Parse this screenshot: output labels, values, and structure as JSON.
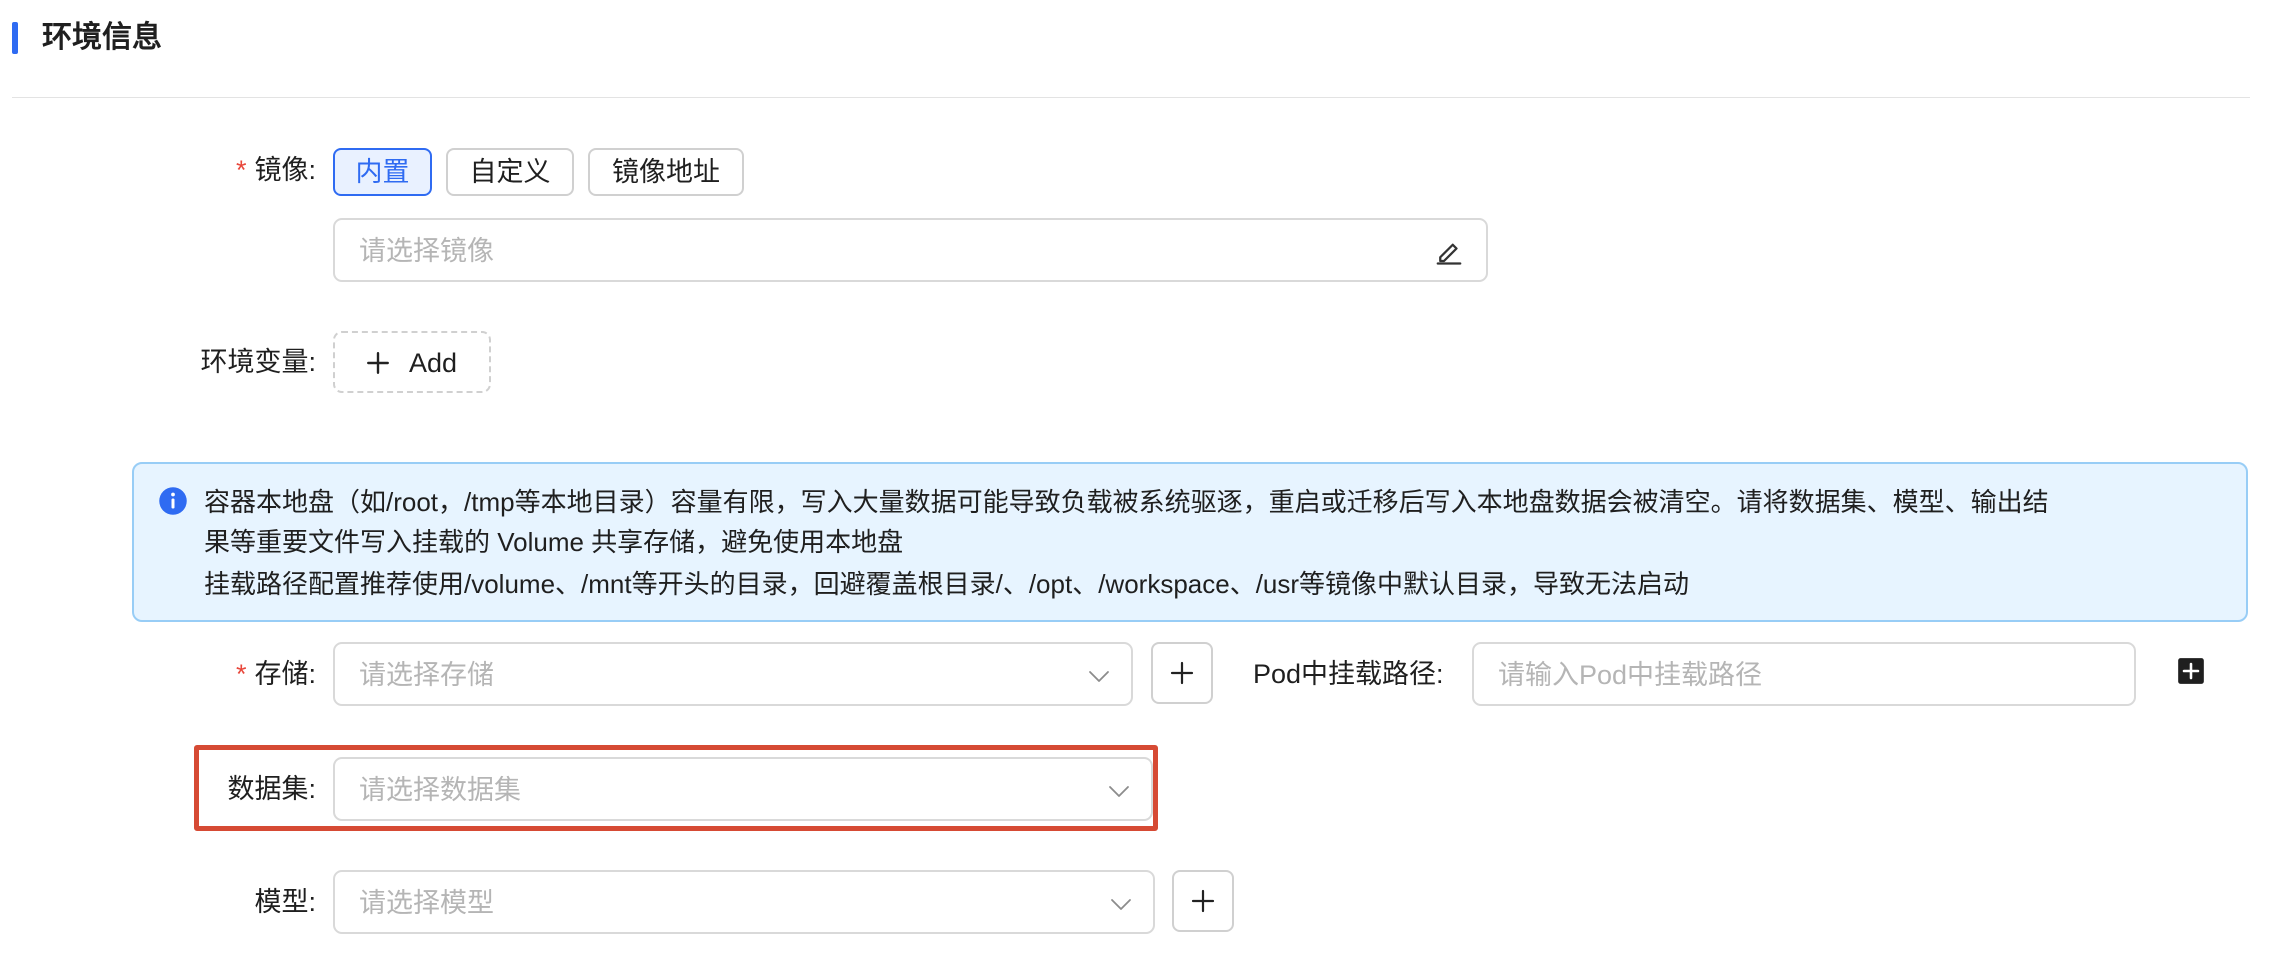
{
  "section": {
    "title": "环境信息"
  },
  "image": {
    "label": "镜像",
    "required_mark": "*",
    "options": [
      "内置",
      "自定义",
      "镜像地址"
    ],
    "selected": "内置",
    "placeholder": "请选择镜像"
  },
  "env_vars": {
    "label": "环境变量",
    "add_label": "Add"
  },
  "alert": {
    "lines": [
      "容器本地盘（如/root，/tmp等本地目录）容量有限，写入大量数据可能导致负载被系统驱逐，重启或迁移后写入本地盘数据会被清空。请将数据集、模型、输出结",
      "果等重要文件写入挂载的 Volume 共享存储，避免使用本地盘",
      "挂载路径配置推荐使用/volume、/mnt等开头的目录，回避覆盖根目录/、/opt、/workspace、/usr等镜像中默认目录，导致无法启动"
    ]
  },
  "storage": {
    "label": "存储",
    "required_mark": "*",
    "placeholder": "请选择存储",
    "mount_label": "Pod中挂载路径",
    "mount_placeholder": "请输入Pod中挂载路径"
  },
  "dataset": {
    "label": "数据集",
    "placeholder": "请选择数据集"
  },
  "model": {
    "label": "模型",
    "placeholder": "请选择模型"
  },
  "label_colon": ":",
  "colors": {
    "accent": "#2f6bf2",
    "required": "#e8473b",
    "highlight": "#d64a34",
    "alert_bg": "#e7f4ff"
  }
}
